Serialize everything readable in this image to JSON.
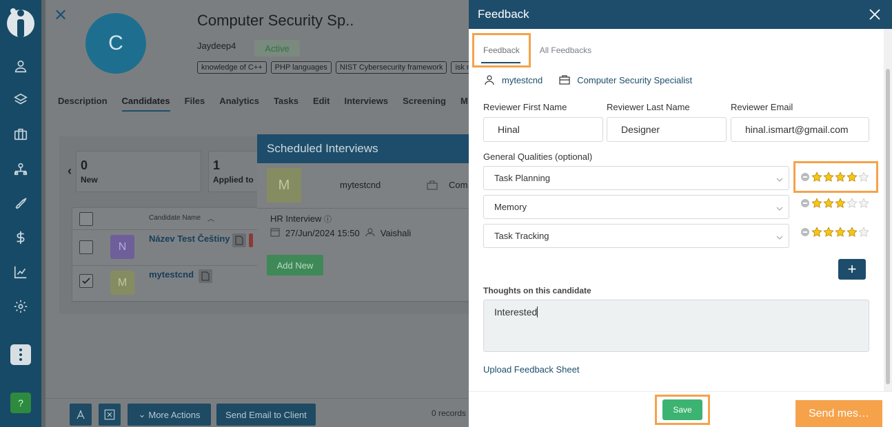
{
  "colors": {
    "sidebar": "#174a66",
    "header": "#1e4d6b",
    "highlight": "#f5a24b",
    "save": "#3cb371",
    "star": "#f5c518"
  },
  "sidebar": {
    "items": [
      {
        "icon": "user-icon"
      },
      {
        "icon": "layers-icon"
      },
      {
        "icon": "briefcase-icon"
      },
      {
        "icon": "org-chart-icon"
      },
      {
        "icon": "rocket-icon"
      },
      {
        "icon": "dollar-icon"
      },
      {
        "icon": "analytics-icon"
      },
      {
        "icon": "gear-icon"
      }
    ],
    "help": "?"
  },
  "job": {
    "avatar_letter": "C",
    "title": "Computer Security Sp..",
    "owner": "Jaydeep4",
    "status": "Active",
    "skills": [
      "knowledge of C++",
      "PHP languages",
      "NIST Cybersecurity framework",
      "isk m"
    ],
    "tabs": [
      "Description",
      "Candidates",
      "Files",
      "Analytics",
      "Tasks",
      "Edit",
      "Interviews",
      "Screening",
      "M"
    ],
    "active_tab": "Candidates",
    "stats": [
      {
        "num": "0",
        "label": "New"
      },
      {
        "num": "1",
        "label": "Applied to"
      }
    ],
    "table_header": "Candidate Name",
    "candidates": [
      {
        "initial": "N",
        "name": "Název Test Češtiny",
        "checked": false
      },
      {
        "initial": "M",
        "name": "mytestcnd",
        "checked": true
      }
    ],
    "bottom": {
      "more_actions": "More Actions",
      "send_email": "Send Email to Client",
      "records": "0 records"
    }
  },
  "scheduled": {
    "title": "Scheduled Interviews",
    "avatar_letter": "M",
    "candidate": "mytestcnd",
    "company": "Com",
    "type": "HR Interview",
    "datetime": "27/Jun/2024 15:50",
    "interviewer": "Vaishali",
    "add_new": "Add New"
  },
  "feedback": {
    "title": "Feedback",
    "tabs": [
      "Feedback",
      "All Feedbacks"
    ],
    "active_tab": "Feedback",
    "candidate_link": "mytestcnd",
    "job_link": "Computer Security Specialist",
    "labels": {
      "first_name": "Reviewer First Name",
      "last_name": "Reviewer Last Name",
      "email": "Reviewer Email",
      "qualities": "General Qualities (optional)",
      "thoughts": "Thoughts on this candidate"
    },
    "values": {
      "first_name": "Hinal",
      "last_name": "Designer",
      "email": "hinal.ismart@gmail.com",
      "thoughts": "Interested"
    },
    "qualities": [
      {
        "name": "Task Planning",
        "rating": 4
      },
      {
        "name": "Memory",
        "rating": 3
      },
      {
        "name": "Task Tracking",
        "rating": 4
      }
    ],
    "max_rating": 5,
    "upload_link": "Upload Feedback Sheet",
    "save": "Save",
    "send_message": "Send mes…"
  }
}
